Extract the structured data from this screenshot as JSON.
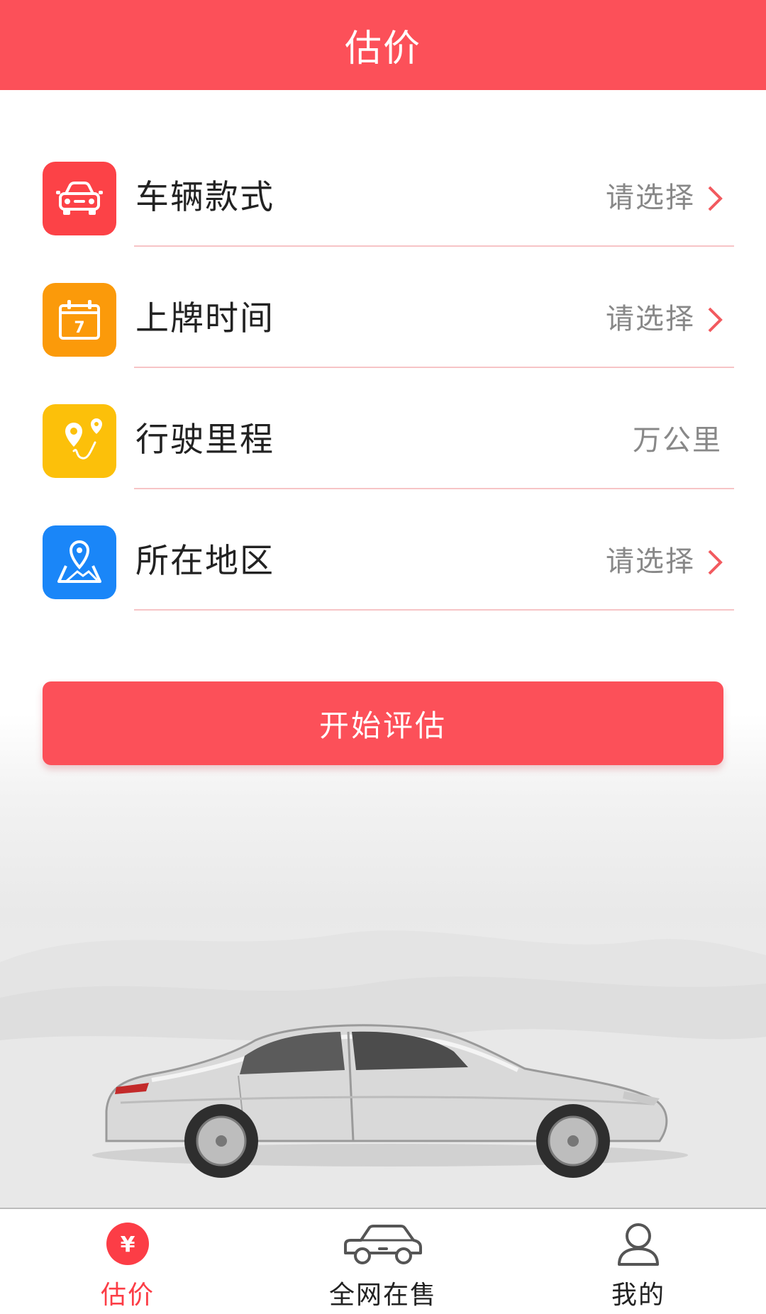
{
  "header": {
    "title": "估价"
  },
  "form": {
    "rows": [
      {
        "label": "车辆款式",
        "value": "请选择",
        "icon": "car-icon",
        "icon_color": "#fc4247"
      },
      {
        "label": "上牌时间",
        "value": "请选择",
        "icon": "calendar-icon",
        "icon_color": "#fb9a0a",
        "calendar_day": "7"
      },
      {
        "label": "行驶里程",
        "value": "万公里",
        "icon": "route-icon",
        "icon_color": "#fcc00a"
      },
      {
        "label": "所在地区",
        "value": "请选择",
        "icon": "map-pin-icon",
        "icon_color": "#1a86f8"
      }
    ],
    "submit_label": "开始评估"
  },
  "tabbar": {
    "tabs": [
      {
        "label": "估价",
        "icon": "yen-icon",
        "active": true,
        "icon_glyph": "¥"
      },
      {
        "label": "全网在售",
        "icon": "car-outline-icon",
        "active": false
      },
      {
        "label": "我的",
        "icon": "user-icon",
        "active": false
      }
    ]
  },
  "colors": {
    "accent": "#fc5059",
    "active_tab": "#fc3d46",
    "divider": "#f7c4c6"
  }
}
